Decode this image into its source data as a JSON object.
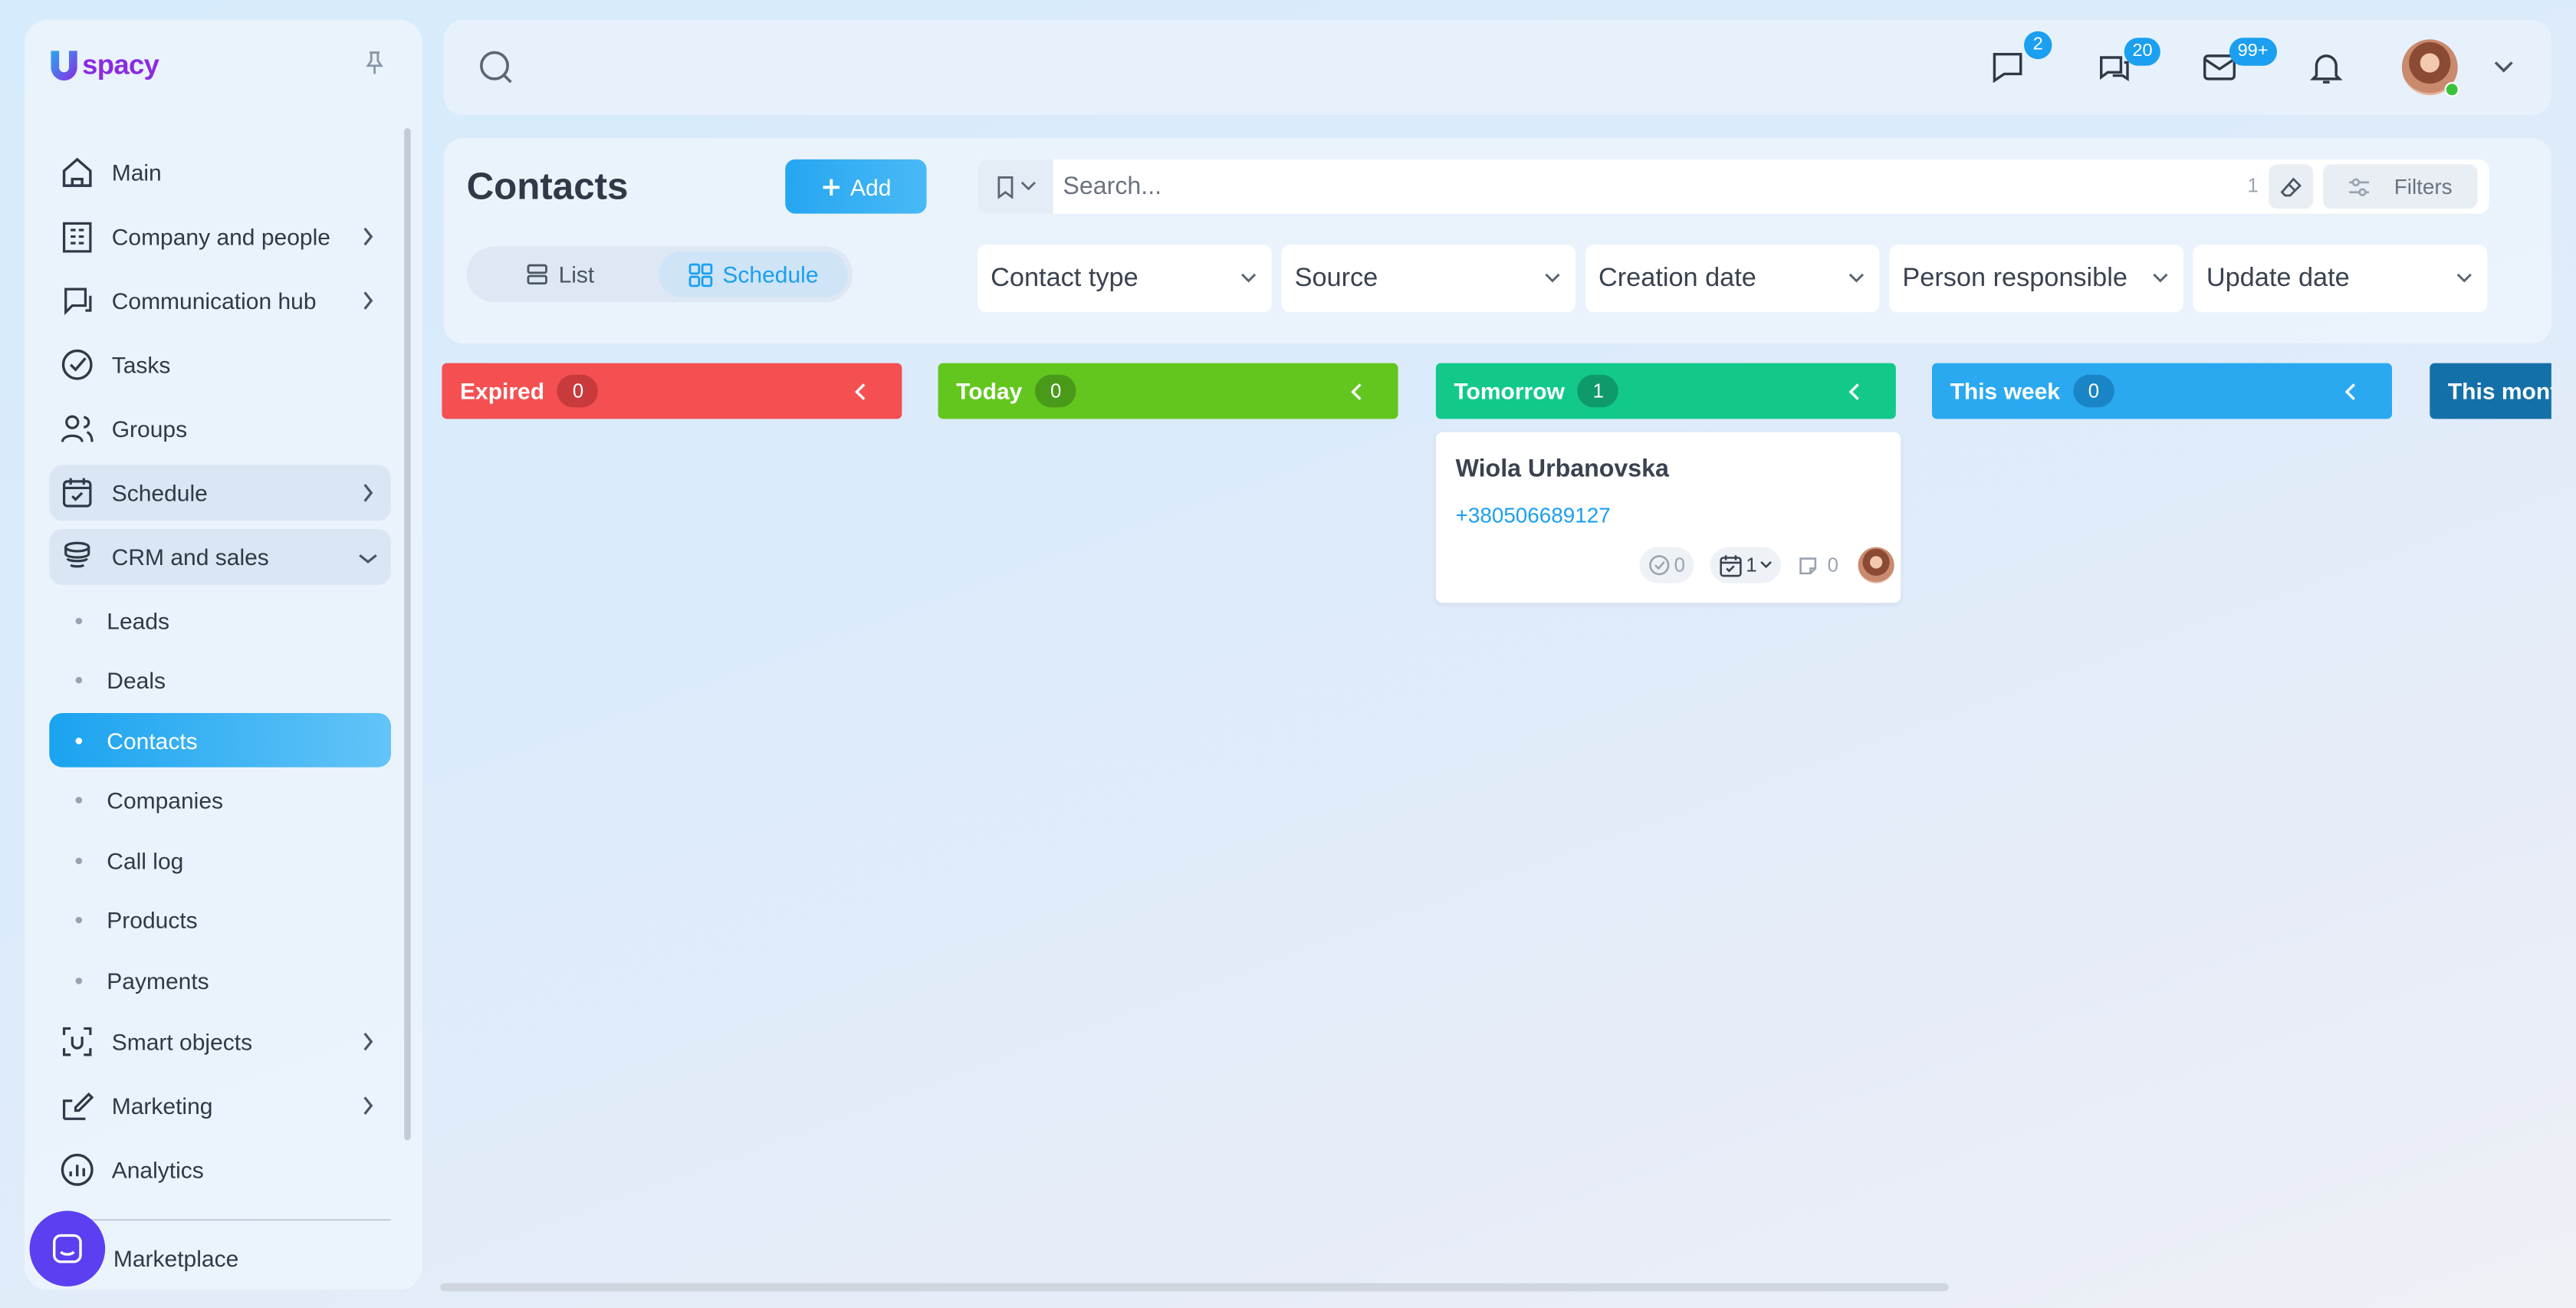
{
  "brand": {
    "logo_text": "spacy",
    "logo_mark": "U"
  },
  "sidebar": {
    "items": [
      {
        "label": "Main",
        "icon": "home-icon"
      },
      {
        "label": "Company and people",
        "icon": "building-icon"
      },
      {
        "label": "Communication hub",
        "icon": "communication-icon"
      },
      {
        "label": "Tasks",
        "icon": "task-check-icon"
      },
      {
        "label": "Groups",
        "icon": "groups-icon"
      },
      {
        "label": "Schedule",
        "icon": "calendar-icon"
      },
      {
        "label": "CRM and sales",
        "icon": "crm-stack-icon"
      }
    ],
    "crm_sub": [
      "Leads",
      "Deals",
      "Contacts",
      "Companies",
      "Call log",
      "Products",
      "Payments"
    ],
    "items_after": [
      {
        "label": "Smart objects",
        "icon": "smart-objects-icon"
      },
      {
        "label": "Marketing",
        "icon": "marketing-icon"
      },
      {
        "label": "Analytics",
        "icon": "analytics-icon"
      }
    ],
    "marketplace": "Marketplace"
  },
  "topbar": {
    "badges": {
      "messages": "2",
      "chats": "20",
      "mail": "99+"
    }
  },
  "panel": {
    "title": "Contacts",
    "add_label": "Add",
    "view_list": "List",
    "view_schedule": "Schedule",
    "search_placeholder": "Search...",
    "result_count": "1",
    "filters_label": "Filters",
    "dropdowns": [
      "Contact type",
      "Source",
      "Creation date",
      "Person responsible",
      "Update date"
    ]
  },
  "board": {
    "columns": [
      {
        "title": "Expired",
        "count": "0",
        "color": "#f45052"
      },
      {
        "title": "Today",
        "count": "0",
        "color": "#63c61f"
      },
      {
        "title": "Tomorrow",
        "count": "1",
        "color": "#12c98a"
      },
      {
        "title": "This week",
        "count": "0",
        "color": "#2aa9f0"
      },
      {
        "title": "This mont",
        "count": "",
        "color": "#1470a8"
      }
    ],
    "card": {
      "name": "Wiola Urbanovska",
      "phone": "+380506689127",
      "tasks_count": "0",
      "events_count": "1",
      "comments_count": "0"
    }
  }
}
